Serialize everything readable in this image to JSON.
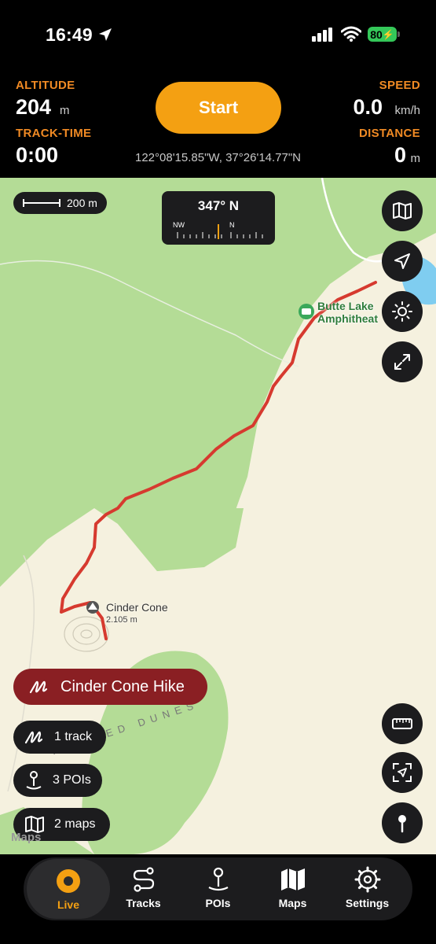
{
  "status_bar": {
    "time": "16:49",
    "battery": "80"
  },
  "header": {
    "altitude": {
      "label": "ALTITUDE",
      "value": "204",
      "unit": "m"
    },
    "track_time": {
      "label": "TRACK-TIME",
      "value": "0:00"
    },
    "speed": {
      "label": "SPEED",
      "value": "0.0",
      "unit": "km/h"
    },
    "distance": {
      "label": "DISTANCE",
      "value": "0",
      "unit": "m"
    },
    "start_label": "Start",
    "coordinates": "122°08'15.85\"W, 37°26'14.77\"N"
  },
  "map": {
    "scale": "200 m",
    "compass": {
      "heading": "347° N",
      "marks": [
        "NW",
        "N"
      ]
    },
    "poi_amphitheater": [
      "Butte Lake",
      "Amphitheat"
    ],
    "peak": {
      "name": "Cinder Cone",
      "elevation": "2.105 m"
    },
    "dunes_label": "PAINTED DUNES",
    "watermark": "Maps"
  },
  "track_chip": "Cinder Cone Hike",
  "summary": [
    {
      "icon": "track-icon",
      "label": "1 track"
    },
    {
      "icon": "poi-pin-icon",
      "label": "3 POIs"
    },
    {
      "icon": "map-icon",
      "label": "2 maps"
    }
  ],
  "tabs": [
    {
      "icon": "live-icon",
      "label": "Live",
      "active": true
    },
    {
      "icon": "tracks-icon",
      "label": "Tracks"
    },
    {
      "icon": "pois-icon",
      "label": "POIs"
    },
    {
      "icon": "maps-icon",
      "label": "Maps"
    },
    {
      "icon": "settings-icon",
      "label": "Settings"
    }
  ],
  "colors": {
    "accent": "#f4a012",
    "label": "#f08a24",
    "track": "#d63a2f",
    "chip": "#8a1f23",
    "forest": "#b4dc96",
    "terrain": "#f5f1df"
  }
}
